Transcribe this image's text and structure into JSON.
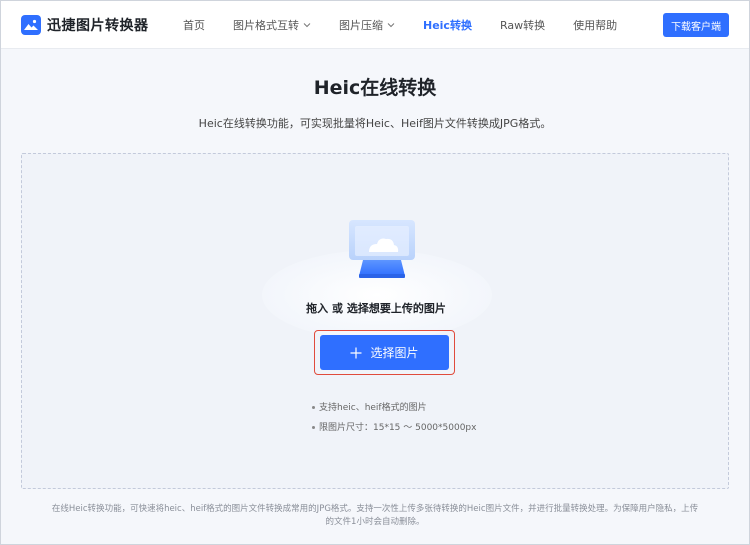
{
  "brand": {
    "name": "迅捷图片转换器",
    "icon": "image-logo-icon",
    "color": "#2f6fff"
  },
  "nav": {
    "items": [
      {
        "label": "首页",
        "has_dropdown": false,
        "active": false
      },
      {
        "label": "图片格式互转",
        "has_dropdown": true,
        "active": false
      },
      {
        "label": "图片压缩",
        "has_dropdown": true,
        "active": false
      },
      {
        "label": "Heic转换",
        "has_dropdown": false,
        "active": true
      },
      {
        "label": "Raw转换",
        "has_dropdown": false,
        "active": false
      },
      {
        "label": "使用帮助",
        "has_dropdown": false,
        "active": false
      }
    ],
    "download_label": "下载客户端"
  },
  "page": {
    "title": "Heic在线转换",
    "subtitle": "Heic在线转换功能，可实现批量将Heic、Heif图片文件转换成JPG格式。"
  },
  "upload": {
    "drop_hint": "拖入 或 选择想要上传的图片",
    "select_label": "选择图片",
    "requirements": [
      "支持heic、heif格式的图片",
      "限图片尺寸：15*15 ～ 5000*5000px"
    ]
  },
  "footer": {
    "note": "在线Heic转换功能，可快速将heic、heif格式的图片文件转换成常用的JPG格式。支持一次性上传多张待转换的Heic图片文件，并进行批量转换处理。为保障用户隐私，上传的文件1小时会自动删除。"
  },
  "colors": {
    "accent": "#2f6fff",
    "highlight_outline": "#e04b3c"
  }
}
